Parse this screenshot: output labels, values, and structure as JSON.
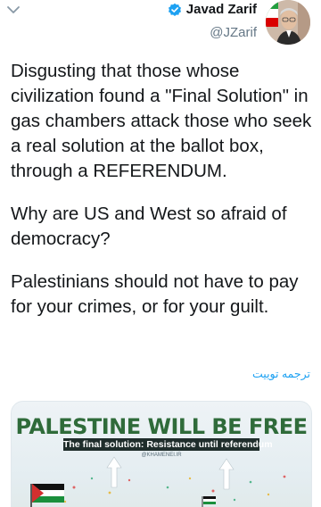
{
  "header": {
    "menu_icon": "chevron-down-icon",
    "author_name": "Javad Zarif",
    "author_handle": "@JZarif",
    "verified_icon": "verified-badge-icon",
    "avatar_icon": "profile-avatar",
    "colors": {
      "verified_blue": "#1da1f2",
      "handle_gray": "#657786"
    }
  },
  "tweet": {
    "paragraphs": [
      "Disgusting that those whose civilization found a \"Final Solution\" in gas chambers attack those who seek a real solution at the ballot box, through a REFERENDUM.",
      "Why are US and West so afraid of democracy?",
      "Palestinians should not have to pay for your crimes, or for your guilt."
    ],
    "translate_label": "ترجمه توییت"
  },
  "media": {
    "headline": "PALESTINE WILL BE FREE",
    "subline": "The final solution: Resistance until referendum",
    "brand": "@KHAMENEI.IR",
    "colors": {
      "headline_green": "#2f6b3a",
      "subline_bg": "#1f2d2b"
    }
  }
}
